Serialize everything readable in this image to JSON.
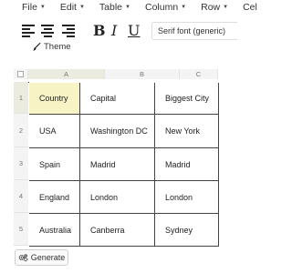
{
  "menubar": {
    "items": [
      {
        "label": "File"
      },
      {
        "label": "Edit"
      },
      {
        "label": "Table"
      },
      {
        "label": "Column"
      },
      {
        "label": "Row"
      },
      {
        "label": "Cel"
      }
    ]
  },
  "toolbar": {
    "bold_label": "B",
    "italic_label": "I",
    "underline_label": "U",
    "font_select_value": "Serif font (generic)",
    "theme_label": "Theme"
  },
  "grid": {
    "column_headers": [
      "A",
      "B",
      "C"
    ],
    "row_headers": [
      "1",
      "2",
      "3",
      "4",
      "5"
    ],
    "selected_cell": "A1",
    "rows": [
      [
        "Country",
        "Capital",
        "Biggest City"
      ],
      [
        "USA",
        "Washington DC",
        "New York"
      ],
      [
        "Spain",
        "Madrid",
        "Madrid"
      ],
      [
        "England",
        "London",
        "London"
      ],
      [
        "Australia",
        "Canberra",
        "Sydney"
      ]
    ]
  },
  "actions": {
    "generate_label": "Generate"
  },
  "colors": {
    "selected_cell": "#f7f3c5",
    "cell_border": "#444444",
    "header_background": "#f4f4f4"
  },
  "icons": {
    "align": [
      "align-left-icon",
      "align-center-icon",
      "align-right-icon"
    ],
    "theme": "brush-icon",
    "generate": "gears-icon"
  }
}
